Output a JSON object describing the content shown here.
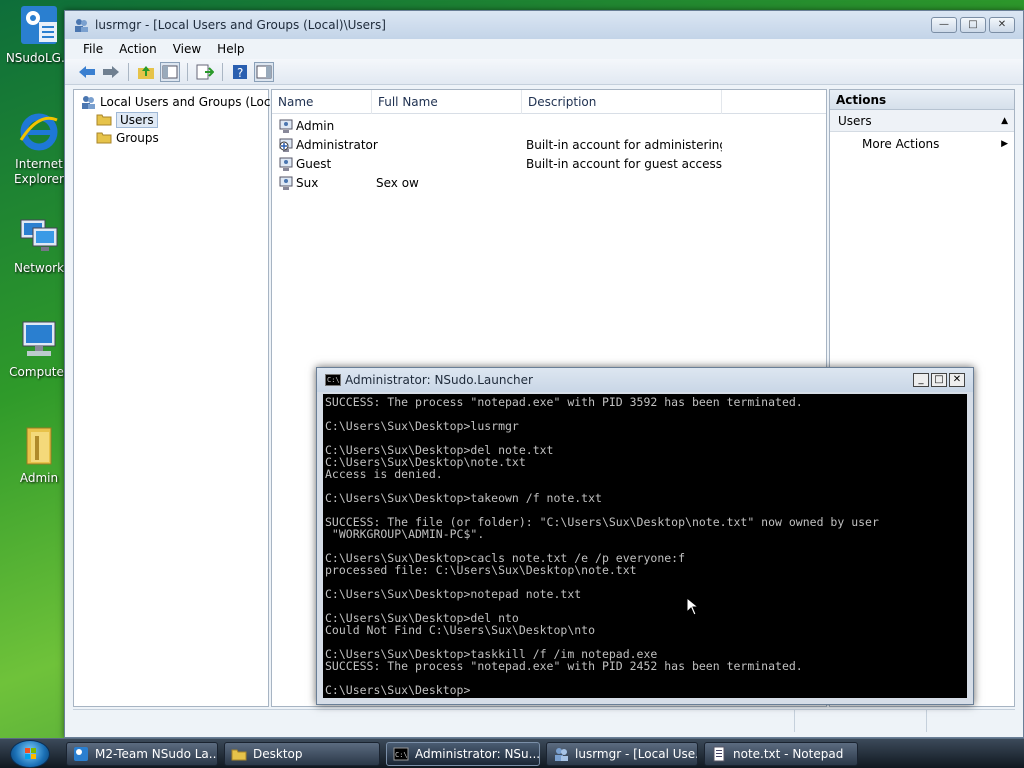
{
  "desktop": {
    "icons": [
      {
        "label": "NSudoLG.e"
      },
      {
        "label": "Internet Explorer"
      },
      {
        "label": "Network"
      },
      {
        "label": "Computer"
      },
      {
        "label": "Admin"
      }
    ]
  },
  "mmc": {
    "title": "lusrmgr - [Local Users and Groups (Local)\\Users]",
    "controls": {
      "minimize": "—",
      "maximize": "□",
      "close": "✕"
    },
    "menu": [
      "File",
      "Action",
      "View",
      "Help"
    ],
    "tree": {
      "root": "Local Users and Groups (Local)",
      "children": [
        "Users",
        "Groups"
      ],
      "selected": "Users"
    },
    "list": {
      "columns": [
        "Name",
        "Full Name",
        "Description"
      ],
      "rows": [
        {
          "name": "Admin",
          "full_name": "",
          "description": ""
        },
        {
          "name": "Administrator",
          "full_name": "",
          "description": "Built-in account for administering..."
        },
        {
          "name": "Guest",
          "full_name": "",
          "description": "Built-in account for guest access t..."
        },
        {
          "name": "Sux",
          "full_name": "Sex ow",
          "description": ""
        }
      ]
    },
    "actions": {
      "header": "Actions",
      "group": "Users",
      "items": [
        "More Actions"
      ]
    }
  },
  "console": {
    "title": "Administrator: NSudo.Launcher",
    "icon_text": "C:\\",
    "lines": [
      "SUCCESS: The process \"notepad.exe\" with PID 3592 has been terminated.",
      "",
      "C:\\Users\\Sux\\Desktop>lusrmgr",
      "",
      "C:\\Users\\Sux\\Desktop>del note.txt",
      "C:\\Users\\Sux\\Desktop\\note.txt",
      "Access is denied.",
      "",
      "C:\\Users\\Sux\\Desktop>takeown /f note.txt",
      "",
      "SUCCESS: The file (or folder): \"C:\\Users\\Sux\\Desktop\\note.txt\" now owned by user",
      " \"WORKGROUP\\ADMIN-PC$\".",
      "",
      "C:\\Users\\Sux\\Desktop>cacls note.txt /e /p everyone:f",
      "processed file: C:\\Users\\Sux\\Desktop\\note.txt",
      "",
      "C:\\Users\\Sux\\Desktop>notepad note.txt",
      "",
      "C:\\Users\\Sux\\Desktop>del nto",
      "Could Not Find C:\\Users\\Sux\\Desktop\\nto",
      "",
      "C:\\Users\\Sux\\Desktop>taskkill /f /im notepad.exe",
      "SUCCESS: The process \"notepad.exe\" with PID 2452 has been terminated.",
      "",
      "C:\\Users\\Sux\\Desktop>"
    ]
  },
  "taskbar": {
    "tasks": [
      {
        "label": "M2-Team NSudo La..."
      },
      {
        "label": "Desktop"
      },
      {
        "label": "Administrator: NSu..."
      },
      {
        "label": "lusrmgr - [Local Use..."
      },
      {
        "label": "note.txt - Notepad"
      }
    ],
    "active_index": 2
  },
  "colors": {
    "selection": "#dfe9f5",
    "console_bg": "#000000",
    "console_fg": "#c0c0c0"
  }
}
